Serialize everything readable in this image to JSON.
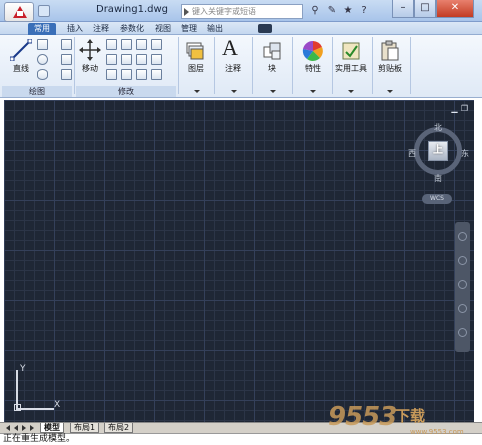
{
  "titlebar": {
    "document_title": "Drawing1.dwg",
    "search_placeholder": "键入关键字或短语"
  },
  "tabs": [
    {
      "label": "常用",
      "active": true
    },
    {
      "label": "插入"
    },
    {
      "label": "注释"
    },
    {
      "label": "参数化"
    },
    {
      "label": "视图"
    },
    {
      "label": "管理"
    },
    {
      "label": "输出"
    }
  ],
  "ribbon": {
    "line_label": "直线",
    "move_label": "移动",
    "layers_label": "图层",
    "annotation_label": "注释",
    "block_label": "块",
    "properties_label": "特性",
    "utilities_label": "实用工具",
    "clipboard_label": "剪贴板",
    "panel_draw": "绘图",
    "panel_modify": "修改"
  },
  "viewcube": {
    "face": "上",
    "north": "北",
    "south": "南",
    "east": "东",
    "west": "西",
    "wcs": "WCS"
  },
  "ucs": {
    "x": "X",
    "y": "Y"
  },
  "layout_tabs": [
    "模型",
    "布局1",
    "布局2"
  ],
  "command_line": "正在重生成模型。",
  "watermark": {
    "main": "9553",
    "sub": "下载",
    "url": "www.9553.com"
  },
  "colors": {
    "accent": "#3a6fb8",
    "canvas": "#1f2735",
    "close": "#c23b22"
  }
}
